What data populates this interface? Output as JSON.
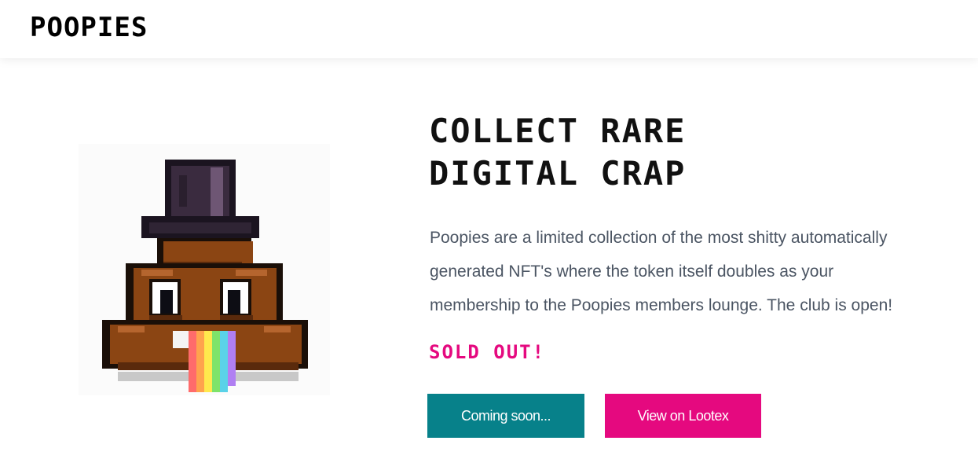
{
  "header": {
    "logo_text": "POOPIES"
  },
  "hero": {
    "headline_line1": "COLLECT RARE",
    "headline_line2": "DIGITAL CRAP",
    "description_line1": "Poopies are a limited collection of the most shitty automatically",
    "description_line2": "generated NFT's where the token itself doubles as your",
    "description_line3": "membership to the Poopies members lounge. The club is open!",
    "status": "SOLD OUT!",
    "image_icon": "pixel-poop-top-hat-rainbow-icon"
  },
  "buttons": {
    "coming_soon_label": "Coming soon...",
    "lootex_label": "View on Lootex"
  },
  "colors": {
    "teal_button": "#07818a",
    "pink_accent": "#e5097f",
    "poop_brown": "#8b4513",
    "hat_purple": "#3a2b3f"
  }
}
